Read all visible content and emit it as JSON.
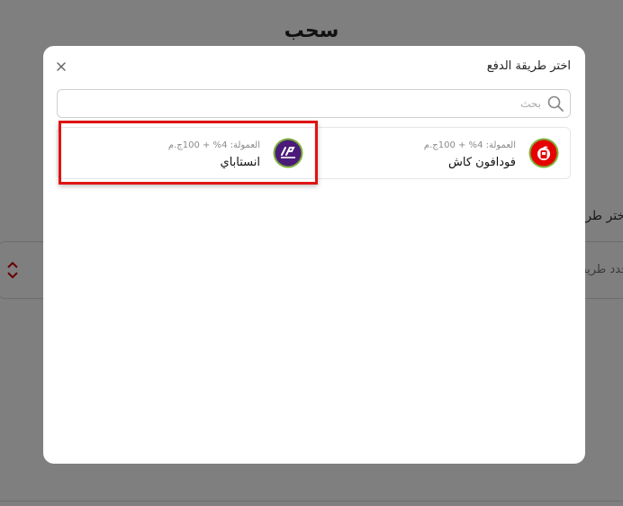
{
  "background": {
    "page_title": "سحب",
    "field_label": "اختر طريقة",
    "select_placeholder": "حدد طريقة"
  },
  "modal": {
    "title": "اختر طريقة الدفع",
    "close_icon": "close-icon",
    "search": {
      "placeholder": "بحث",
      "value": "",
      "icon": "search-icon"
    },
    "methods": [
      {
        "name": "فودافون كاش",
        "fee": "العمولة: 4% + 100ج.م",
        "icon": "vodafone-cash-logo",
        "color": "#e60000"
      },
      {
        "name": "انستاباي",
        "fee": "العمولة: 4% + 100ج.م",
        "icon": "instapay-logo",
        "color": "#4b1b7a",
        "highlighted": true
      }
    ]
  },
  "colors": {
    "highlight": "#e01313",
    "overlay": "rgba(0,0,0,0.5)"
  }
}
